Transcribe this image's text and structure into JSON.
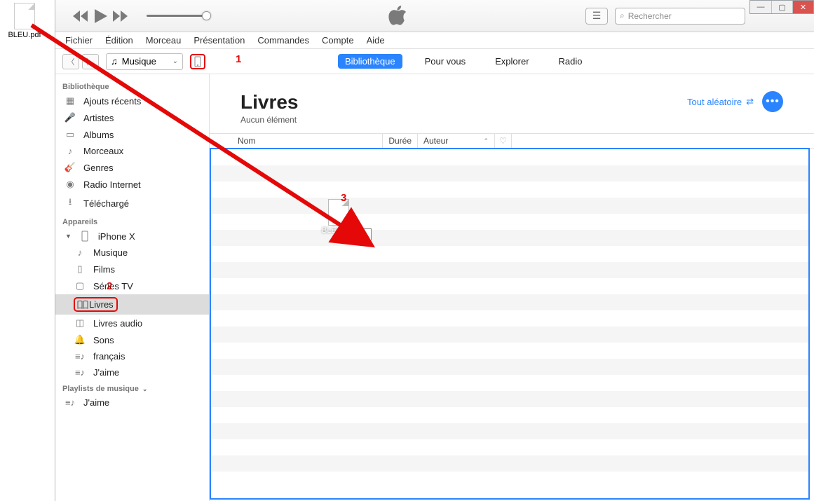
{
  "desktop_file": "BLEU.pdf",
  "menu": [
    "Fichier",
    "Édition",
    "Morceau",
    "Présentation",
    "Commandes",
    "Compte",
    "Aide"
  ],
  "search_placeholder": "Rechercher",
  "media_selector": "Musique",
  "tabs": {
    "lib": "Bibliothèque",
    "foryou": "Pour vous",
    "explore": "Explorer",
    "radio": "Radio"
  },
  "sidebar": {
    "s1_title": "Bibliothèque",
    "s1_items": [
      "Ajouts récents",
      "Artistes",
      "Albums",
      "Morceaux",
      "Genres",
      "Radio Internet",
      "Téléchargé"
    ],
    "s2_title": "Appareils",
    "device_name": "iPhone X",
    "device_items": [
      "Musique",
      "Films",
      "Séries TV",
      "Livres",
      "Livres audio",
      "Sons",
      "français",
      "J'aime"
    ],
    "s3_title": "Playlists de musique",
    "s3_items": [
      "J'aime"
    ]
  },
  "header": {
    "title": "Livres",
    "subtitle": "Aucun élément",
    "shuffle": "Tout aléatoire"
  },
  "columns": {
    "nom": "Nom",
    "duree": "Durée",
    "auteur": "Auteur"
  },
  "drag": {
    "filename": "BLEU.pdf",
    "badge": "Lien"
  },
  "annotations": {
    "n1": "1",
    "n2": "2",
    "n3": "3"
  }
}
